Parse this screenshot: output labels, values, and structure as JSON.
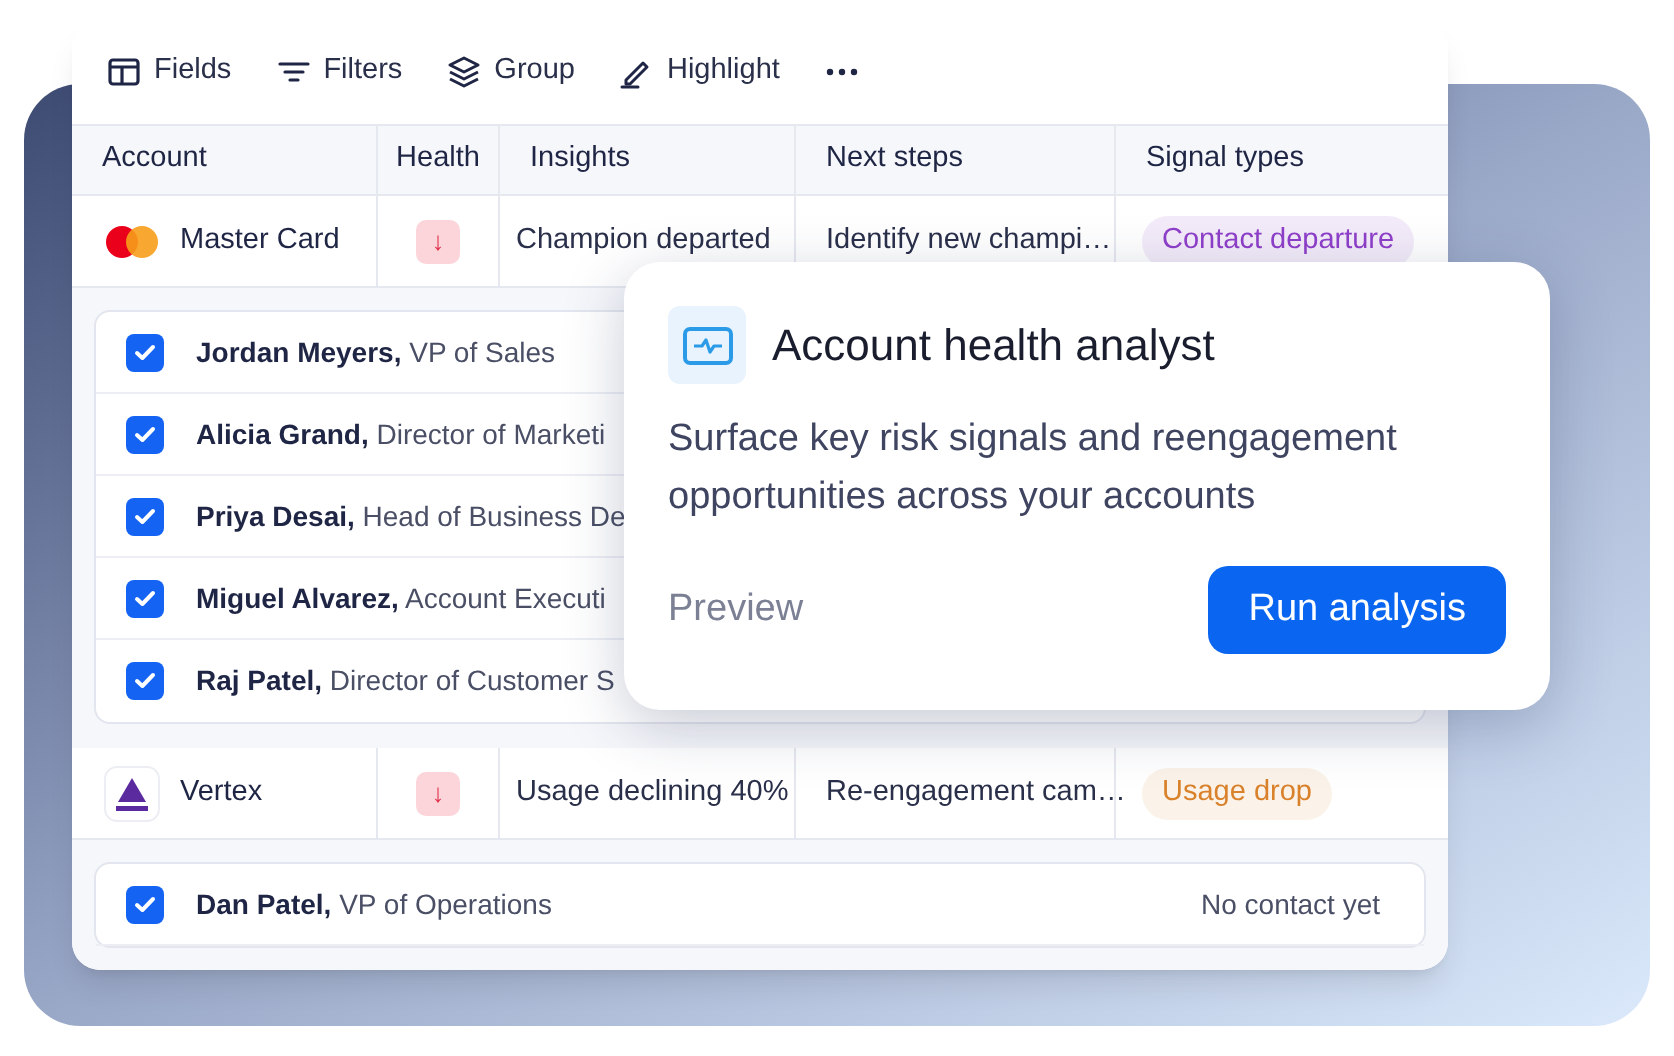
{
  "toolbar": [
    {
      "label": "Fields",
      "kind": "fields"
    },
    {
      "label": "Filters",
      "kind": "filters"
    },
    {
      "label": "Group",
      "kind": "group"
    },
    {
      "label": "Highlight",
      "kind": "highlight"
    },
    {
      "kind": "more"
    }
  ],
  "table": {
    "columns": [
      "Account",
      "Health",
      "Insights",
      "Next steps",
      "Signal types"
    ],
    "rows": [
      {
        "account": "Master Card",
        "logo": {
          "kind": "mastercard"
        },
        "health": "↓",
        "insight": "Champion departed",
        "next_step": "Identify new champi…",
        "signal": {
          "label": "Contact departure",
          "color": "#8e3fc9"
        },
        "contacts": [
          {
            "text": "**Jordan Meyers,** VP of Sales",
            "checked": true
          },
          {
            "text": "**Alicia Grand,** Director of Marketi",
            "checked": true
          },
          {
            "text": "**Priya Desai,** Head of Business De",
            "checked": true
          },
          {
            "text": "**Miguel Alvarez,** Account Executi",
            "checked": true
          },
          {
            "text": "**Raj Patel,** Director of Customer S",
            "checked": true
          }
        ]
      },
      {
        "account": "Vertex",
        "logo": {
          "kind": "triangle"
        },
        "health": "↓",
        "insight": "Usage declining 40%",
        "next_step": "Re-engagement cam…",
        "signal": {
          "label": "Usage drop",
          "color": "#d9822b"
        },
        "contacts": [
          {
            "text": "**Dan Patel,** VP of Operations",
            "checked": true,
            "status": "No contact yet"
          }
        ]
      }
    ]
  },
  "popup": {
    "title": "Account health analyst",
    "description": "Surface key risk signals and reengagement opportunities across your accounts",
    "secondary": "Preview",
    "primary": "Run analysis"
  }
}
